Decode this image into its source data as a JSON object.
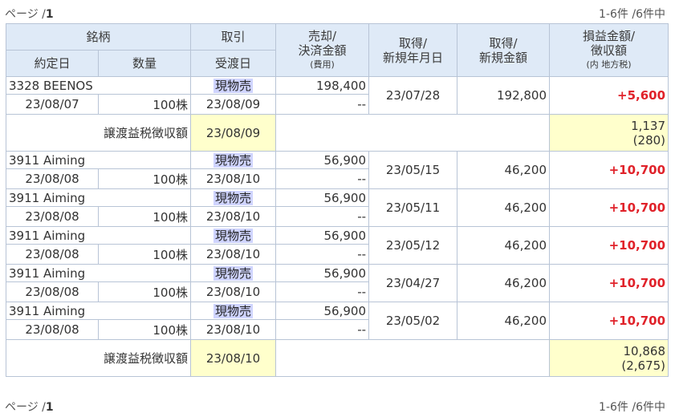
{
  "pager": {
    "page_label": "ページ /",
    "page_number": "1",
    "range": "1-6件 /6件中"
  },
  "headers": {
    "stock": "銘柄",
    "trade": "取引",
    "sale": [
      "売却/",
      "決済金額"
    ],
    "fee": "(費用)",
    "acq_date": [
      "取得/",
      "新規年月日"
    ],
    "acq_amount": [
      "取得/",
      "新規金額"
    ],
    "pl": [
      "損益金額/",
      "徴収額"
    ],
    "pl_sub": "(内 地方税)",
    "contract_date": "約定日",
    "quantity": "数量",
    "delivery_date": "受渡日"
  },
  "groups": [
    {
      "rows": [
        {
          "stock": "3328 BEENOS",
          "trade": "現物売",
          "sale_amount": "198,400",
          "fee": "--",
          "acq_date": "23/07/28",
          "acq_amount": "192,800",
          "profit": "+5,600",
          "contract_date": "23/08/07",
          "quantity": "100株",
          "delivery_date": "23/08/09"
        }
      ],
      "tax": {
        "label": "譲渡益税徴収額",
        "date": "23/08/09",
        "amount": "1,137",
        "local": "(280)"
      }
    },
    {
      "rows": [
        {
          "stock": "3911 Aiming",
          "trade": "現物売",
          "sale_amount": "56,900",
          "fee": "--",
          "acq_date": "23/05/15",
          "acq_amount": "46,200",
          "profit": "+10,700",
          "contract_date": "23/08/08",
          "quantity": "100株",
          "delivery_date": "23/08/10"
        },
        {
          "stock": "3911 Aiming",
          "trade": "現物売",
          "sale_amount": "56,900",
          "fee": "--",
          "acq_date": "23/05/11",
          "acq_amount": "46,200",
          "profit": "+10,700",
          "contract_date": "23/08/08",
          "quantity": "100株",
          "delivery_date": "23/08/10"
        },
        {
          "stock": "3911 Aiming",
          "trade": "現物売",
          "sale_amount": "56,900",
          "fee": "--",
          "acq_date": "23/05/12",
          "acq_amount": "46,200",
          "profit": "+10,700",
          "contract_date": "23/08/08",
          "quantity": "100株",
          "delivery_date": "23/08/10"
        },
        {
          "stock": "3911 Aiming",
          "trade": "現物売",
          "sale_amount": "56,900",
          "fee": "--",
          "acq_date": "23/04/27",
          "acq_amount": "46,200",
          "profit": "+10,700",
          "contract_date": "23/08/08",
          "quantity": "100株",
          "delivery_date": "23/08/10"
        },
        {
          "stock": "3911 Aiming",
          "trade": "現物売",
          "sale_amount": "56,900",
          "fee": "--",
          "acq_date": "23/05/02",
          "acq_amount": "46,200",
          "profit": "+10,700",
          "contract_date": "23/08/08",
          "quantity": "100株",
          "delivery_date": "23/08/10"
        }
      ],
      "tax": {
        "label": "譲渡益税徴収額",
        "date": "23/08/10",
        "amount": "10,868",
        "local": "(2,675)"
      }
    }
  ],
  "colors": {
    "header_bg": "#dfeaf7",
    "border": "#b8c4d6",
    "profit": "#e0222a",
    "tax_bg": "#ffffcc",
    "trade_bg": "#cfd4ff"
  }
}
